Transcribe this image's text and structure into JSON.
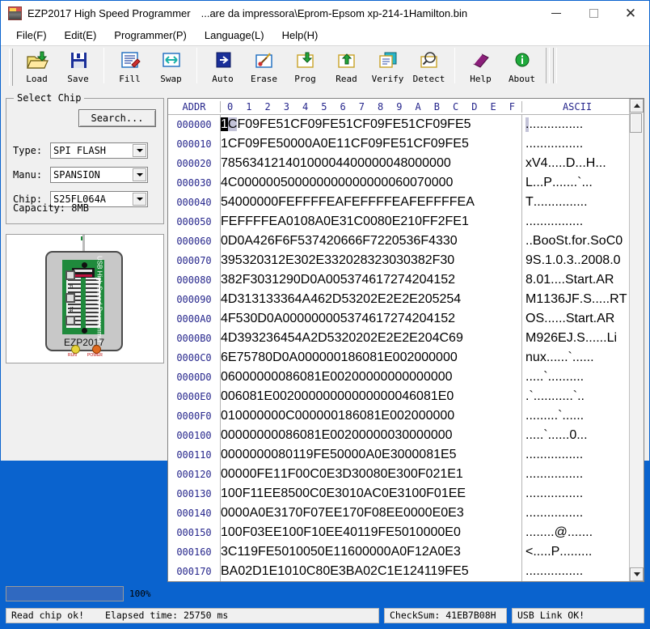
{
  "window": {
    "app_title": "EZP2017 High Speed Programmer",
    "file_path": "...are da impressora\\Eprom-Epsom xp-214-1Hamilton.bin",
    "minimize_label": "–",
    "maximize_label": "□",
    "close_label": "✕"
  },
  "menu": {
    "items": [
      {
        "label": "File(F)"
      },
      {
        "label": "Edit(E)"
      },
      {
        "label": "Programmer(P)"
      },
      {
        "label": "Language(L)"
      },
      {
        "label": "Help(H)"
      }
    ]
  },
  "toolbar": {
    "buttons": [
      {
        "label": "Load",
        "icon": "open-folder-icon"
      },
      {
        "label": "Save",
        "icon": "floppy-disk-icon"
      },
      {
        "label": "Fill",
        "icon": "fill-page-icon"
      },
      {
        "label": "Swap",
        "icon": "swap-arrows-icon"
      },
      {
        "label": "Auto",
        "icon": "auto-arrow-icon"
      },
      {
        "label": "Erase",
        "icon": "erase-brush-icon"
      },
      {
        "label": "Prog",
        "icon": "program-down-arrow-icon"
      },
      {
        "label": "Read",
        "icon": "read-up-arrow-icon"
      },
      {
        "label": "Verify",
        "icon": "verify-pages-icon"
      },
      {
        "label": "Detect",
        "icon": "magnifier-detect-icon"
      },
      {
        "label": "Help",
        "icon": "help-book-icon"
      },
      {
        "label": "About",
        "icon": "info-circle-icon"
      }
    ]
  },
  "select_chip": {
    "legend": "Select Chip",
    "search_label": "Search...",
    "type_label": "Type:",
    "type_value": "SPI FLASH",
    "manu_label": "Manu:",
    "manu_value": "SPANSION",
    "chip_label": "Chip:",
    "chip_value": "S25FL064A",
    "capacity_label": "Capacity: 8MB"
  },
  "device_image": {
    "board_name": "EZP2017",
    "side_text": "USB High Speed Programmer",
    "led_run_label": "RUN",
    "led_power_label": "POWER",
    "chip_text": "EZP2017"
  },
  "hex_view": {
    "addr_header": "ADDR",
    "ascii_header": "ASCII",
    "col_headers": [
      "0",
      "1",
      "2",
      "3",
      "4",
      "5",
      "6",
      "7",
      "8",
      "9",
      "A",
      "B",
      "C",
      "D",
      "E",
      "F"
    ],
    "cursor_row": 0,
    "cursor_col": 0,
    "rows": [
      {
        "addr": "000000",
        "bytes": [
          "1C",
          "F0",
          "9F",
          "E5",
          "1C",
          "F0",
          "9F",
          "E5",
          "1C",
          "F0",
          "9F",
          "E5",
          "1C",
          "F0",
          "9F",
          "E5"
        ],
        "ascii": ". . . . . . . . . . . . . . . ."
      },
      {
        "addr": "000010",
        "bytes": [
          "1C",
          "F0",
          "9F",
          "E5",
          "00",
          "00",
          "A0",
          "E1",
          "1C",
          "F0",
          "9F",
          "E5",
          "1C",
          "F0",
          "9F",
          "E5"
        ],
        "ascii": ". . . . . . . . . . . . . . . ."
      },
      {
        "addr": "000020",
        "bytes": [
          "78",
          "56",
          "34",
          "12",
          "14",
          "01",
          "00",
          "00",
          "44",
          "00",
          "00",
          "00",
          "48",
          "00",
          "00",
          "00"
        ],
        "ascii": "x V 4 . . . . . D . . . H . . ."
      },
      {
        "addr": "000030",
        "bytes": [
          "4C",
          "00",
          "00",
          "00",
          "50",
          "00",
          "00",
          "00",
          "00",
          "00",
          "00",
          "00",
          "60",
          "07",
          "00",
          "00"
        ],
        "ascii": "L . . . P . . . . . . . ` . . ."
      },
      {
        "addr": "000040",
        "bytes": [
          "54",
          "00",
          "00",
          "00",
          "FE",
          "FF",
          "FF",
          "EA",
          "FE",
          "FF",
          "FF",
          "EA",
          "FE",
          "FF",
          "FF",
          "EA"
        ],
        "ascii": "T . . . . . . . . . . . . . . ."
      },
      {
        "addr": "000050",
        "bytes": [
          "FE",
          "FF",
          "FF",
          "EA",
          "01",
          "08",
          "A0",
          "E3",
          "1C",
          "00",
          "80",
          "E2",
          "10",
          "FF",
          "2F",
          "E1"
        ],
        "ascii": ". . . . . . . . . . . . . . . ."
      },
      {
        "addr": "000060",
        "bytes": [
          "0D",
          "0A",
          "42",
          "6F",
          "6F",
          "53",
          "74",
          "20",
          "66",
          "6F",
          "72",
          "20",
          "53",
          "6F",
          "43",
          "30"
        ],
        "ascii": ". . B o o S t . f o r . S o C 0"
      },
      {
        "addr": "000070",
        "bytes": [
          "39",
          "53",
          "20",
          "31",
          "2E",
          "30",
          "2E",
          "33",
          "20",
          "28",
          "32",
          "30",
          "30",
          "38",
          "2F",
          "30"
        ],
        "ascii": "9 S . 1 . 0 . 3 . . 2 0 0 8 . 0"
      },
      {
        "addr": "000080",
        "bytes": [
          "38",
          "2F",
          "30",
          "31",
          "29",
          "0D",
          "0A",
          "00",
          "53",
          "74",
          "61",
          "72",
          "74",
          "20",
          "41",
          "52"
        ],
        "ascii": "8 . 0 1 . . . . S t a r t . A R"
      },
      {
        "addr": "000090",
        "bytes": [
          "4D",
          "31",
          "31",
          "33",
          "36",
          "4A",
          "46",
          "2D",
          "53",
          "20",
          "2E",
          "2E",
          "2E",
          "20",
          "52",
          "54"
        ],
        "ascii": "M 1 1 3 6 J F . S . . . . . R T"
      },
      {
        "addr": "0000A0",
        "bytes": [
          "4F",
          "53",
          "0D",
          "0A",
          "00",
          "00",
          "00",
          "00",
          "53",
          "74",
          "61",
          "72",
          "74",
          "20",
          "41",
          "52"
        ],
        "ascii": "O S . . . . . . S t a r t . A R"
      },
      {
        "addr": "0000B0",
        "bytes": [
          "4D",
          "39",
          "32",
          "36",
          "45",
          "4A",
          "2D",
          "53",
          "20",
          "20",
          "2E",
          "2E",
          "2E",
          "20",
          "4C",
          "69"
        ],
        "ascii": "M 9 2 6 E J . S . . . . . . L i"
      },
      {
        "addr": "0000C0",
        "bytes": [
          "6E",
          "75",
          "78",
          "0D",
          "0A",
          "00",
          "00",
          "00",
          "18",
          "60",
          "81",
          "E0",
          "02",
          "00",
          "00",
          "00"
        ],
        "ascii": "n u x . . . . . . ` . . . . . ."
      },
      {
        "addr": "0000D0",
        "bytes": [
          "06",
          "00",
          "00",
          "00",
          "08",
          "60",
          "81",
          "E0",
          "02",
          "00",
          "00",
          "00",
          "00",
          "00",
          "00",
          "00"
        ],
        "ascii": ". . . . . ` . . . . . . . . . ."
      },
      {
        "addr": "0000E0",
        "bytes": [
          "00",
          "60",
          "81",
          "E0",
          "02",
          "00",
          "00",
          "00",
          "00",
          "00",
          "00",
          "00",
          "04",
          "60",
          "81",
          "E0"
        ],
        "ascii": ". ` . . . . . . . . . . . ` . ."
      },
      {
        "addr": "0000F0",
        "bytes": [
          "01",
          "00",
          "00",
          "00",
          "0C",
          "00",
          "00",
          "00",
          "18",
          "60",
          "81",
          "E0",
          "02",
          "00",
          "00",
          "00"
        ],
        "ascii": ". . . . . . . . . ` . . . . . ."
      },
      {
        "addr": "000100",
        "bytes": [
          "00",
          "00",
          "00",
          "00",
          "08",
          "60",
          "81",
          "E0",
          "02",
          "00",
          "00",
          "00",
          "30",
          "00",
          "00",
          "00"
        ],
        "ascii": ". . . . . ` . . . . . . 0 . . ."
      },
      {
        "addr": "000110",
        "bytes": [
          "00",
          "00",
          "00",
          "00",
          "80",
          "11",
          "9F",
          "E5",
          "00",
          "00",
          "A0",
          "E3",
          "00",
          "00",
          "81",
          "E5"
        ],
        "ascii": ". . . . . . . . . . . . . . . ."
      },
      {
        "addr": "000120",
        "bytes": [
          "00",
          "00",
          "0F",
          "E1",
          "1F",
          "00",
          "C0",
          "E3",
          "D3",
          "00",
          "80",
          "E3",
          "00",
          "F0",
          "21",
          "E1"
        ],
        "ascii": ". . . . . . . . . . . . . . . ."
      },
      {
        "addr": "000130",
        "bytes": [
          "10",
          "0F",
          "11",
          "EE",
          "85",
          "00",
          "C0",
          "E3",
          "01",
          "0A",
          "C0",
          "E3",
          "10",
          "0F",
          "01",
          "EE"
        ],
        "ascii": ". . . . . . . . . . . . . . . ."
      },
      {
        "addr": "000140",
        "bytes": [
          "00",
          "00",
          "A0",
          "E3",
          "17",
          "0F",
          "07",
          "EE",
          "17",
          "0F",
          "08",
          "EE",
          "00",
          "00",
          "E0",
          "E3"
        ],
        "ascii": ". . . . . . . . . . . . . . . ."
      },
      {
        "addr": "000150",
        "bytes": [
          "10",
          "0F",
          "03",
          "EE",
          "10",
          "0F",
          "10",
          "EE",
          "40",
          "11",
          "9F",
          "E5",
          "01",
          "00",
          "00",
          "E0"
        ],
        "ascii": ". . . . . . . . @ . . . . . . ."
      },
      {
        "addr": "000160",
        "bytes": [
          "3C",
          "11",
          "9F",
          "E5",
          "01",
          "00",
          "50",
          "E1",
          "16",
          "00",
          "00",
          "0A",
          "0F",
          "12",
          "A0",
          "E3"
        ],
        "ascii": "< . . . . . P . . . . . . . . ."
      },
      {
        "addr": "000170",
        "bytes": [
          "BA",
          "02",
          "D1",
          "E1",
          "01",
          "0C",
          "80",
          "E3",
          "BA",
          "02",
          "C1",
          "E1",
          "24",
          "11",
          "9F",
          "E5"
        ],
        "ascii": ". . . . . . . . . . . . . . . ."
      }
    ]
  },
  "progress": {
    "percent_label": "100%",
    "percent_value": 100,
    "fill_color": "#3069c0"
  },
  "status": {
    "message": "Read chip ok!",
    "elapsed_label": "Elapsed time: 25750 ms",
    "checksum": "CheckSum: 41EB7B08H",
    "usb": "USB Link OK!"
  }
}
